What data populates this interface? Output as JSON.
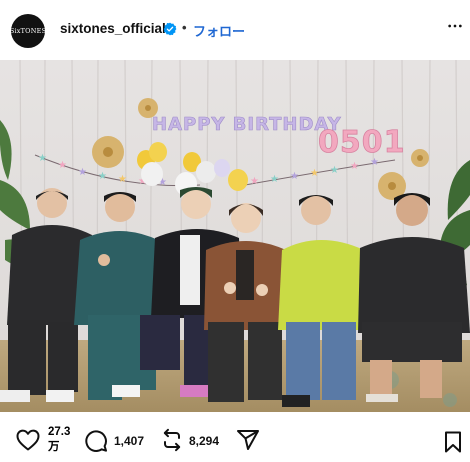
{
  "account": {
    "avatar_text": "SixTONES",
    "username": "sixtones_official",
    "separator": "•",
    "follow_label": "フォロー"
  },
  "photo": {
    "banner_text": "HAPPY BIRTHDAY",
    "balloon_numbers": "0501"
  },
  "actions": {
    "likes_number": "27.3",
    "likes_unit": "万",
    "comments": "1,407",
    "reposts": "8,294"
  },
  "colors": {
    "follow_blue": "#1f67d2",
    "verified_blue": "#0095f6"
  },
  "icons": [
    "more-icon",
    "verified-icon",
    "heart-icon",
    "comment-icon",
    "repost-icon",
    "share-icon",
    "bookmark-icon"
  ]
}
